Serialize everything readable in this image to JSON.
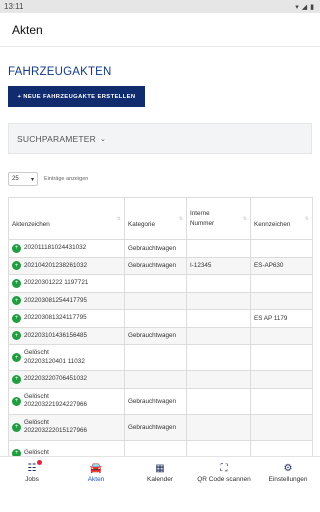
{
  "status": {
    "time": "13:11"
  },
  "app_bar": {
    "title": "Akten"
  },
  "page": {
    "section_title": "FAHRZEUGAKTEN",
    "new_button": "+ NEUE FAHRZEUGAKTE ERSTELLEN",
    "search_panel": "SUCHPARAMETER",
    "per_page_value": "25",
    "per_page_label": "Einträge anzeigen"
  },
  "table": {
    "headers": [
      "Aktenzeichen",
      "Kategorie",
      "Interne Nummer",
      "Kennzeichen"
    ],
    "rows": [
      {
        "aktenzeichen": "202011181024431032",
        "kategorie": "Gebrauchtwagen",
        "interne_nummer": "",
        "kennzeichen": ""
      },
      {
        "aktenzeichen": "202104201238261032",
        "kategorie": "Gebrauchtwagen",
        "interne_nummer": "I-12345",
        "kennzeichen": "ES-AP630"
      },
      {
        "aktenzeichen": "20220301222 1197721",
        "kategorie": "",
        "interne_nummer": "",
        "kennzeichen": ""
      },
      {
        "aktenzeichen": "202203081254417795",
        "kategorie": "",
        "interne_nummer": "",
        "kennzeichen": ""
      },
      {
        "aktenzeichen": "202203081324117795",
        "kategorie": "",
        "interne_nummer": "",
        "kennzeichen": "ES AP 1179"
      },
      {
        "aktenzeichen": "202203101436156485",
        "kategorie": "Gebrauchtwagen",
        "interne_nummer": "",
        "kennzeichen": ""
      },
      {
        "aktenzeichen": "Gelöscht 202203120401 11032",
        "kategorie": "",
        "interne_nummer": "",
        "kennzeichen": ""
      },
      {
        "aktenzeichen": "202203220706451032",
        "kategorie": "",
        "interne_nummer": "",
        "kennzeichen": ""
      },
      {
        "aktenzeichen": "Gelöscht 202203221924227966",
        "kategorie": "Gebrauchtwagen",
        "interne_nummer": "",
        "kennzeichen": ""
      },
      {
        "aktenzeichen": "Gelöscht 202203222015127966",
        "kategorie": "Gebrauchtwagen",
        "interne_nummer": "",
        "kennzeichen": ""
      },
      {
        "aktenzeichen": "Gelöscht",
        "kategorie": "",
        "interne_nummer": "",
        "kennzeichen": ""
      }
    ]
  },
  "bottom_nav": [
    {
      "label": "Jobs",
      "icon": "jobs-icon"
    },
    {
      "label": "Akten",
      "icon": "car-icon"
    },
    {
      "label": "Kalender",
      "icon": "calendar-icon"
    },
    {
      "label": "QR Code scannen",
      "icon": "qr-icon"
    },
    {
      "label": "Einstellungen",
      "icon": "gear-icon"
    }
  ],
  "colors": {
    "accent": "#123a86",
    "button": "#112c6e",
    "nav_active": "#1c52b8",
    "plus": "#1f9d3f",
    "badge": "#e0243a"
  }
}
